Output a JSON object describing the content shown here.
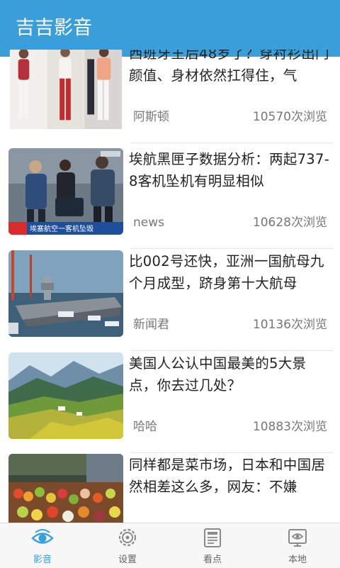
{
  "app": {
    "title": "吉吉影音"
  },
  "feed": [
    {
      "headline": "西班牙王后48岁了？穿衬衫出门颜值、身材依然扛得住，气",
      "source": "阿斯顿",
      "views": "10570次浏览"
    },
    {
      "headline": "埃航黑匣子数据分析：两起737-8客机坠机有明显相似",
      "source": "news",
      "views": "10628次浏览",
      "thumb_text": "埃塞航空一客机坠毁"
    },
    {
      "headline": "比002号还快，亚洲一国航母九个月成型，跻身第十大航母",
      "source": "新闻君",
      "views": "10136次浏览"
    },
    {
      "headline": "美国人公认中国最美的5大景点，你去过几处？",
      "source": "哈哈",
      "views": "10883次浏览"
    },
    {
      "headline": "同样都是菜市场，日本和中国居然相差这么多，网友：不嫌",
      "source": "",
      "views": ""
    }
  ],
  "tabs": [
    {
      "label": "影音",
      "icon": "eye-icon",
      "active": true
    },
    {
      "label": "设置",
      "icon": "gear-icon",
      "active": false
    },
    {
      "label": "看点",
      "icon": "newspaper-icon",
      "active": false
    },
    {
      "label": "本地",
      "icon": "monitor-eye-icon",
      "active": false
    }
  ],
  "colors": {
    "accent": "#3a9fd8",
    "text": "#222222",
    "muted": "#777777"
  }
}
